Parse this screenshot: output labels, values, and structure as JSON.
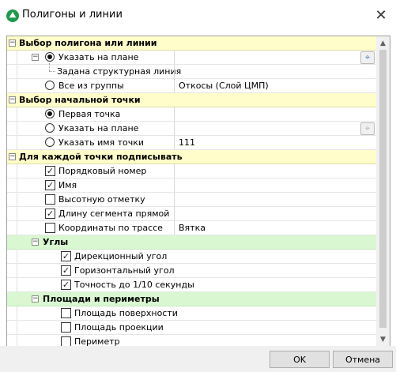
{
  "window": {
    "title": "Полигоны и линии",
    "icon": "app-logo-icon",
    "close_glyph": "✕"
  },
  "groups": {
    "polygon_select": "Выбор полигона или линии",
    "start_point": "Выбор начальной точки",
    "label_each": "Для каждой точки подписывать",
    "angles": "Углы",
    "areas": "Площади и периметры"
  },
  "items": {
    "specify_on_plan": "Указать на плане",
    "structural_line_set": "Задана структурная линия",
    "all_from_group": "Все из группы",
    "all_from_group_value": "Откосы (Слой ЦМП)",
    "first_point": "Первая точка",
    "specify_on_plan_2": "Указать на плане",
    "specify_point_name": "Указать имя точки",
    "point_name_value": "111",
    "serial_number": "Порядковый номер",
    "name": "Имя",
    "elevation": "Высотную отметку",
    "segment_length": "Длину сегмента прямой",
    "route_coords": "Координаты по трассе",
    "route_coords_value": "Вятка",
    "directional_angle": "Дирекционный угол",
    "horizontal_angle": "Горизонтальный угол",
    "precision": "Точность до 1/10 секунды",
    "surface_area": "Площадь поверхности",
    "projection_area": "Площадь проекции",
    "perimeter": "Периметр"
  },
  "checks": {
    "serial_number": true,
    "name": true,
    "elevation": false,
    "segment_length": true,
    "route_coords": false,
    "directional_angle": true,
    "horizontal_angle": true,
    "precision": true,
    "surface_area": false,
    "projection_area": false,
    "perimeter": false
  },
  "buttons": {
    "ok": "OK",
    "cancel": "Отмена"
  },
  "glyphs": {
    "check": "✓",
    "collapse": "−",
    "target": "⌖",
    "scroll_up": "▲",
    "scroll_down": "▼"
  },
  "colors": {
    "group_yellow": "#fffdc9",
    "group_green": "#d9f7d0",
    "app_icon": "#1f9a4b"
  }
}
